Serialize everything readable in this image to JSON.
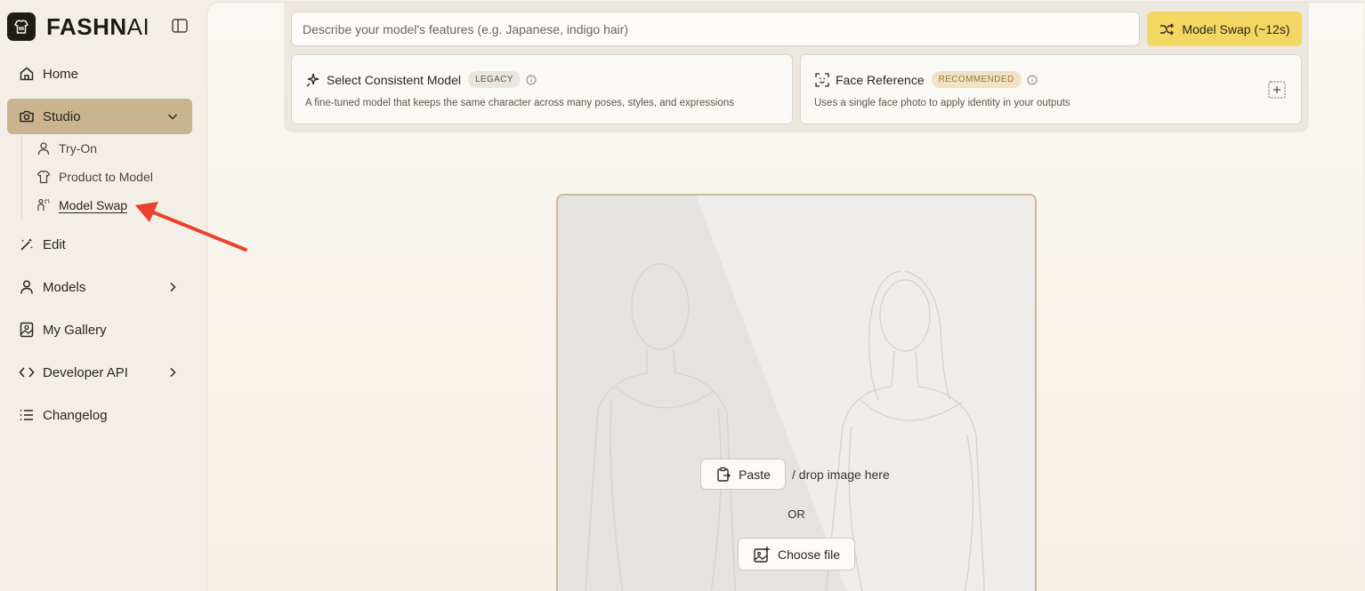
{
  "brand": {
    "name_bold": "FASHN",
    "name_thin": "AI"
  },
  "sidebar": {
    "items": [
      {
        "label": "Home",
        "icon": "home-icon"
      },
      {
        "label": "Studio",
        "icon": "camera-icon"
      },
      {
        "label": "Edit",
        "icon": "magic-wand-icon"
      },
      {
        "label": "Models",
        "icon": "user-icon"
      },
      {
        "label": "My Gallery",
        "icon": "gallery-icon"
      },
      {
        "label": "Developer API",
        "icon": "code-icon"
      },
      {
        "label": "Changelog",
        "icon": "list-icon"
      }
    ],
    "studio_sub": [
      {
        "label": "Try-On",
        "icon": "person-icon"
      },
      {
        "label": "Product to Model",
        "icon": "shirt-icon"
      },
      {
        "label": "Model Swap",
        "icon": "swap-model-icon"
      }
    ]
  },
  "prompt": {
    "placeholder": "Describe your model's features (e.g. Japanese, indigo hair)"
  },
  "swap_button": {
    "label": "Model Swap (~12s)"
  },
  "cards": {
    "consistent": {
      "title": "Select Consistent Model",
      "badge": "LEGACY",
      "desc": "A fine-tuned model that keeps the same character across many poses, styles, and expressions"
    },
    "face": {
      "title": "Face Reference",
      "badge": "RECOMMENDED",
      "desc": "Uses a single face photo to apply identity in your outputs"
    }
  },
  "upload": {
    "paste_label": "Paste",
    "drop_text": "/ drop image here",
    "or_text": "OR",
    "choose_label": "Choose file"
  },
  "colors": {
    "accent": "#f4d662",
    "active_nav": "#c9b48f",
    "annotation_arrow": "#e8412c"
  }
}
